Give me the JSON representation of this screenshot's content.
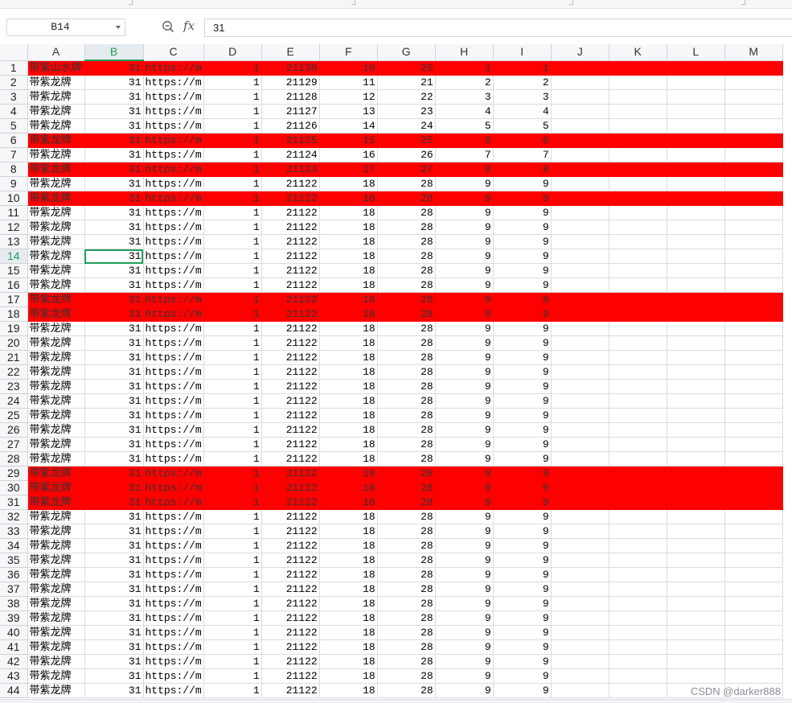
{
  "formula_bar": {
    "name_box": "B14",
    "zoom_icon": "zoom-icon",
    "fx_label": "fx",
    "formula_value": "31"
  },
  "columns": [
    "A",
    "B",
    "C",
    "D",
    "E",
    "F",
    "G",
    "H",
    "I",
    "J",
    "K",
    "L",
    "M"
  ],
  "selected_column": "B",
  "selected_row": 14,
  "active_cell": "B14",
  "highlight_color": "#ff0000",
  "selection_color": "#1f9f5a",
  "highlighted_rows": [
    1,
    6,
    8,
    10,
    17,
    18,
    29,
    30,
    31
  ],
  "rows": [
    {
      "n": "1",
      "a": "带紫山水牌",
      "b": "31",
      "c": "https://m",
      "d": "1",
      "e": "21130",
      "f": "10",
      "g": "20",
      "h": "1",
      "i": "1"
    },
    {
      "n": "2",
      "a": "带紫龙牌",
      "b": "31",
      "c": "https://m",
      "d": "1",
      "e": "21129",
      "f": "11",
      "g": "21",
      "h": "2",
      "i": "2"
    },
    {
      "n": "3",
      "a": "带紫龙牌",
      "b": "31",
      "c": "https://m",
      "d": "1",
      "e": "21128",
      "f": "12",
      "g": "22",
      "h": "3",
      "i": "3"
    },
    {
      "n": "4",
      "a": "带紫龙牌",
      "b": "31",
      "c": "https://m",
      "d": "1",
      "e": "21127",
      "f": "13",
      "g": "23",
      "h": "4",
      "i": "4"
    },
    {
      "n": "5",
      "a": "带紫龙牌",
      "b": "31",
      "c": "https://m",
      "d": "1",
      "e": "21126",
      "f": "14",
      "g": "24",
      "h": "5",
      "i": "5"
    },
    {
      "n": "6",
      "a": "带紫龙牌",
      "b": "31",
      "c": "https://m",
      "d": "1",
      "e": "21125",
      "f": "15",
      "g": "25",
      "h": "6",
      "i": "6"
    },
    {
      "n": "7",
      "a": "带紫龙牌",
      "b": "31",
      "c": "https://m",
      "d": "1",
      "e": "21124",
      "f": "16",
      "g": "26",
      "h": "7",
      "i": "7"
    },
    {
      "n": "8",
      "a": "带紫龙牌",
      "b": "31",
      "c": "https://m",
      "d": "1",
      "e": "21123",
      "f": "17",
      "g": "27",
      "h": "8",
      "i": "8"
    },
    {
      "n": "9",
      "a": "带紫龙牌",
      "b": "31",
      "c": "https://m",
      "d": "1",
      "e": "21122",
      "f": "18",
      "g": "28",
      "h": "9",
      "i": "9"
    },
    {
      "n": "10",
      "a": "带紫龙牌",
      "b": "31",
      "c": "https://m",
      "d": "1",
      "e": "21122",
      "f": "18",
      "g": "28",
      "h": "9",
      "i": "9"
    },
    {
      "n": "11",
      "a": "带紫龙牌",
      "b": "31",
      "c": "https://m",
      "d": "1",
      "e": "21122",
      "f": "18",
      "g": "28",
      "h": "9",
      "i": "9"
    },
    {
      "n": "12",
      "a": "带紫龙牌",
      "b": "31",
      "c": "https://m",
      "d": "1",
      "e": "21122",
      "f": "18",
      "g": "28",
      "h": "9",
      "i": "9"
    },
    {
      "n": "13",
      "a": "带紫龙牌",
      "b": "31",
      "c": "https://m",
      "d": "1",
      "e": "21122",
      "f": "18",
      "g": "28",
      "h": "9",
      "i": "9"
    },
    {
      "n": "14",
      "a": "带紫龙牌",
      "b": "31",
      "c": "https://m",
      "d": "1",
      "e": "21122",
      "f": "18",
      "g": "28",
      "h": "9",
      "i": "9"
    },
    {
      "n": "15",
      "a": "带紫龙牌",
      "b": "31",
      "c": "https://m",
      "d": "1",
      "e": "21122",
      "f": "18",
      "g": "28",
      "h": "9",
      "i": "9"
    },
    {
      "n": "16",
      "a": "带紫龙牌",
      "b": "31",
      "c": "https://m",
      "d": "1",
      "e": "21122",
      "f": "18",
      "g": "28",
      "h": "9",
      "i": "9"
    },
    {
      "n": "17",
      "a": "带紫龙牌",
      "b": "31",
      "c": "https://m",
      "d": "1",
      "e": "21122",
      "f": "18",
      "g": "28",
      "h": "9",
      "i": "9"
    },
    {
      "n": "18",
      "a": "带紫龙牌",
      "b": "31",
      "c": "https://m",
      "d": "1",
      "e": "21122",
      "f": "18",
      "g": "28",
      "h": "9",
      "i": "9"
    },
    {
      "n": "19",
      "a": "带紫龙牌",
      "b": "31",
      "c": "https://m",
      "d": "1",
      "e": "21122",
      "f": "18",
      "g": "28",
      "h": "9",
      "i": "9"
    },
    {
      "n": "20",
      "a": "带紫龙牌",
      "b": "31",
      "c": "https://m",
      "d": "1",
      "e": "21122",
      "f": "18",
      "g": "28",
      "h": "9",
      "i": "9"
    },
    {
      "n": "21",
      "a": "带紫龙牌",
      "b": "31",
      "c": "https://m",
      "d": "1",
      "e": "21122",
      "f": "18",
      "g": "28",
      "h": "9",
      "i": "9"
    },
    {
      "n": "22",
      "a": "带紫龙牌",
      "b": "31",
      "c": "https://m",
      "d": "1",
      "e": "21122",
      "f": "18",
      "g": "28",
      "h": "9",
      "i": "9"
    },
    {
      "n": "23",
      "a": "带紫龙牌",
      "b": "31",
      "c": "https://m",
      "d": "1",
      "e": "21122",
      "f": "18",
      "g": "28",
      "h": "9",
      "i": "9"
    },
    {
      "n": "24",
      "a": "带紫龙牌",
      "b": "31",
      "c": "https://m",
      "d": "1",
      "e": "21122",
      "f": "18",
      "g": "28",
      "h": "9",
      "i": "9"
    },
    {
      "n": "25",
      "a": "带紫龙牌",
      "b": "31",
      "c": "https://m",
      "d": "1",
      "e": "21122",
      "f": "18",
      "g": "28",
      "h": "9",
      "i": "9"
    },
    {
      "n": "26",
      "a": "带紫龙牌",
      "b": "31",
      "c": "https://m",
      "d": "1",
      "e": "21122",
      "f": "18",
      "g": "28",
      "h": "9",
      "i": "9"
    },
    {
      "n": "27",
      "a": "带紫龙牌",
      "b": "31",
      "c": "https://m",
      "d": "1",
      "e": "21122",
      "f": "18",
      "g": "28",
      "h": "9",
      "i": "9"
    },
    {
      "n": "28",
      "a": "带紫龙牌",
      "b": "31",
      "c": "https://m",
      "d": "1",
      "e": "21122",
      "f": "18",
      "g": "28",
      "h": "9",
      "i": "9"
    },
    {
      "n": "29",
      "a": "带紫龙牌",
      "b": "31",
      "c": "https://m",
      "d": "1",
      "e": "21122",
      "f": "18",
      "g": "28",
      "h": "9",
      "i": "9"
    },
    {
      "n": "30",
      "a": "带紫龙牌",
      "b": "31",
      "c": "https://m",
      "d": "1",
      "e": "21122",
      "f": "18",
      "g": "28",
      "h": "9",
      "i": "9"
    },
    {
      "n": "31",
      "a": "带紫龙牌",
      "b": "31",
      "c": "https://m",
      "d": "1",
      "e": "21122",
      "f": "18",
      "g": "28",
      "h": "9",
      "i": "9"
    },
    {
      "n": "32",
      "a": "带紫龙牌",
      "b": "31",
      "c": "https://m",
      "d": "1",
      "e": "21122",
      "f": "18",
      "g": "28",
      "h": "9",
      "i": "9"
    },
    {
      "n": "33",
      "a": "带紫龙牌",
      "b": "31",
      "c": "https://m",
      "d": "1",
      "e": "21122",
      "f": "18",
      "g": "28",
      "h": "9",
      "i": "9"
    },
    {
      "n": "34",
      "a": "带紫龙牌",
      "b": "31",
      "c": "https://m",
      "d": "1",
      "e": "21122",
      "f": "18",
      "g": "28",
      "h": "9",
      "i": "9"
    },
    {
      "n": "35",
      "a": "带紫龙牌",
      "b": "31",
      "c": "https://m",
      "d": "1",
      "e": "21122",
      "f": "18",
      "g": "28",
      "h": "9",
      "i": "9"
    },
    {
      "n": "36",
      "a": "带紫龙牌",
      "b": "31",
      "c": "https://m",
      "d": "1",
      "e": "21122",
      "f": "18",
      "g": "28",
      "h": "9",
      "i": "9"
    },
    {
      "n": "37",
      "a": "带紫龙牌",
      "b": "31",
      "c": "https://m",
      "d": "1",
      "e": "21122",
      "f": "18",
      "g": "28",
      "h": "9",
      "i": "9"
    },
    {
      "n": "38",
      "a": "带紫龙牌",
      "b": "31",
      "c": "https://m",
      "d": "1",
      "e": "21122",
      "f": "18",
      "g": "28",
      "h": "9",
      "i": "9"
    },
    {
      "n": "39",
      "a": "带紫龙牌",
      "b": "31",
      "c": "https://m",
      "d": "1",
      "e": "21122",
      "f": "18",
      "g": "28",
      "h": "9",
      "i": "9"
    },
    {
      "n": "40",
      "a": "带紫龙牌",
      "b": "31",
      "c": "https://m",
      "d": "1",
      "e": "21122",
      "f": "18",
      "g": "28",
      "h": "9",
      "i": "9"
    },
    {
      "n": "41",
      "a": "带紫龙牌",
      "b": "31",
      "c": "https://m",
      "d": "1",
      "e": "21122",
      "f": "18",
      "g": "28",
      "h": "9",
      "i": "9"
    },
    {
      "n": "42",
      "a": "带紫龙牌",
      "b": "31",
      "c": "https://m",
      "d": "1",
      "e": "21122",
      "f": "18",
      "g": "28",
      "h": "9",
      "i": "9"
    },
    {
      "n": "43",
      "a": "带紫龙牌",
      "b": "31",
      "c": "https://m",
      "d": "1",
      "e": "21122",
      "f": "18",
      "g": "28",
      "h": "9",
      "i": "9"
    },
    {
      "n": "44",
      "a": "带紫龙牌",
      "b": "31",
      "c": "https://m",
      "d": "1",
      "e": "21122",
      "f": "18",
      "g": "28",
      "h": "9",
      "i": "9"
    }
  ],
  "watermark": "CSDN @darker888"
}
